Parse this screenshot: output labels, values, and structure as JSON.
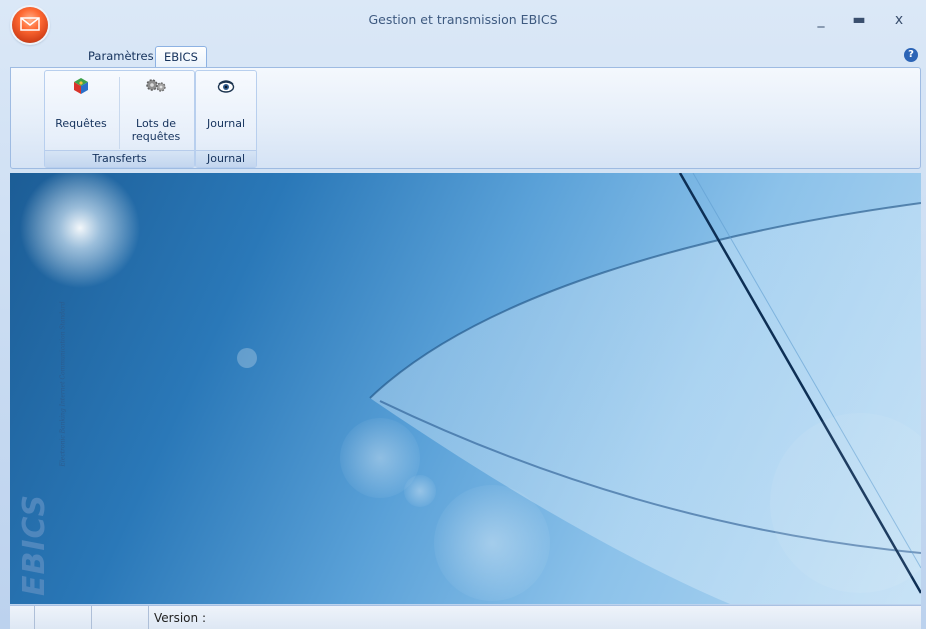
{
  "window": {
    "title": "Gestion et transmission EBICS"
  },
  "tabs": [
    {
      "label": "Paramètres",
      "active": false
    },
    {
      "label": "EBICS",
      "active": true
    }
  ],
  "ribbon": {
    "groups": [
      {
        "label": "Transferts",
        "buttons": [
          {
            "label": "Requêtes",
            "icon": "cube-icon"
          },
          {
            "label1": "Lots de",
            "label2": "requêtes",
            "icon": "gears-icon"
          }
        ]
      },
      {
        "label": "Journal",
        "buttons": [
          {
            "label": "Journal",
            "icon": "eye-icon"
          }
        ]
      }
    ]
  },
  "banner": {
    "logo": "EBICS",
    "tagline": "Electronic Banking Internet Communication Standard"
  },
  "status": {
    "version_label": "Version :"
  },
  "colors": {
    "accent": "#2c64b6",
    "orb": "#ff6a33"
  }
}
